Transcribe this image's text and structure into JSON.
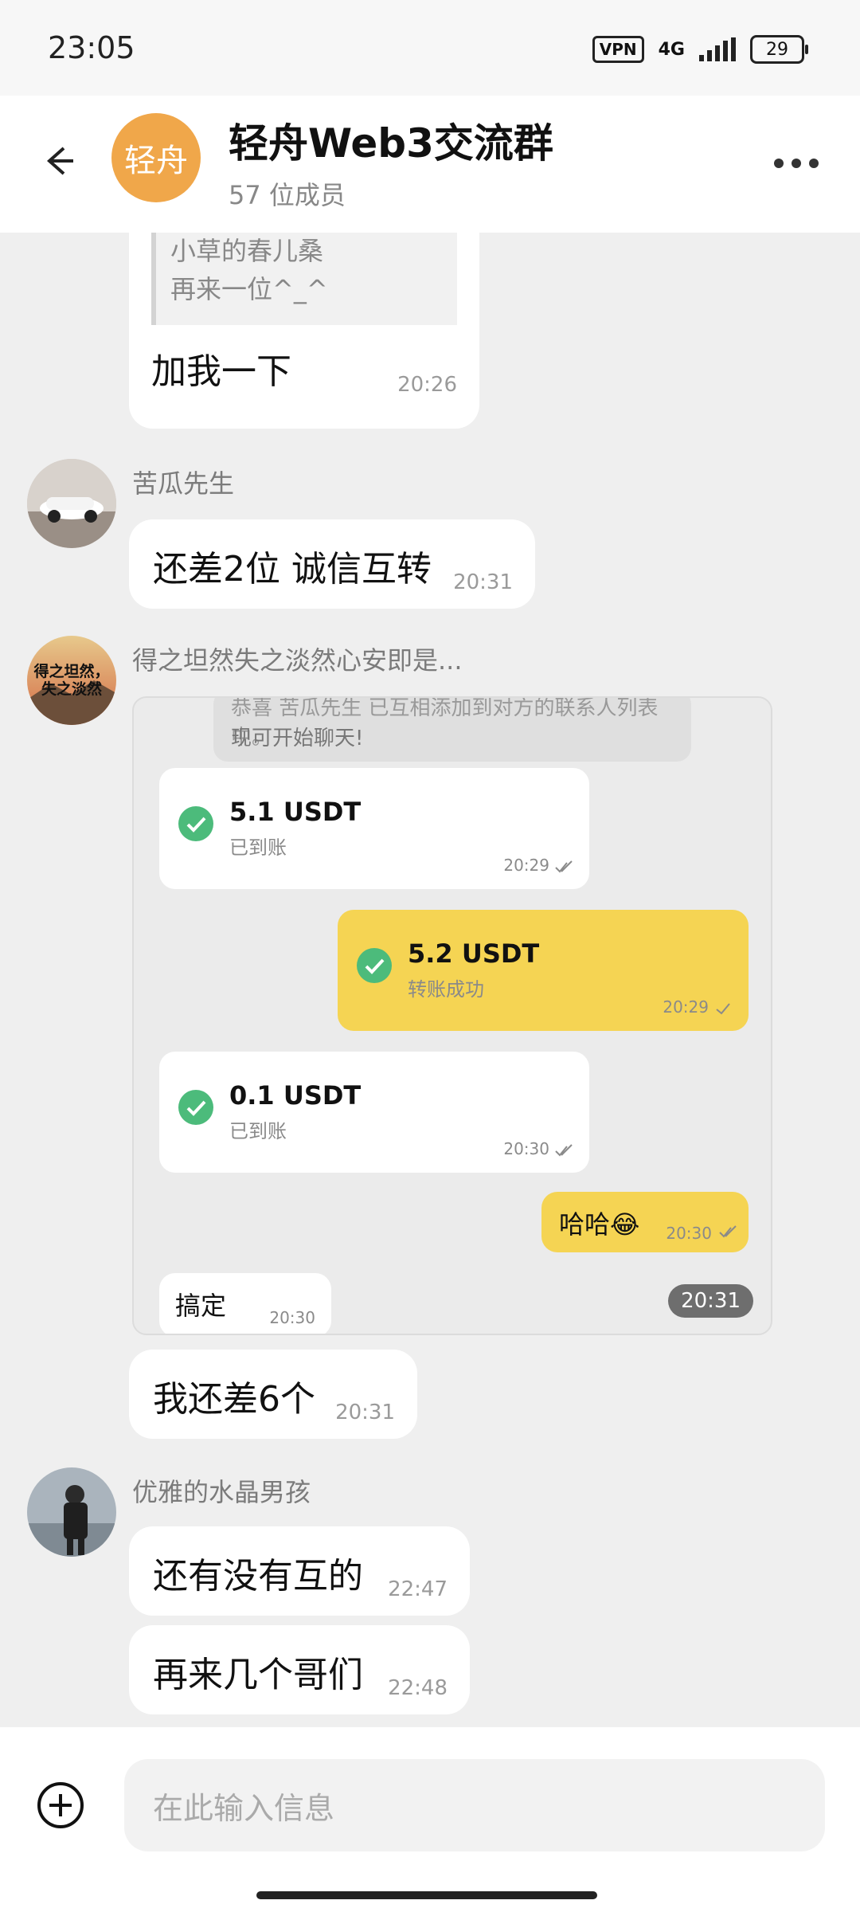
{
  "status_bar": {
    "time": "23:05",
    "vpn": "VPN",
    "network": "4G",
    "battery": "29"
  },
  "header": {
    "avatar_text": "轻舟",
    "title": "轻舟Web3交流群",
    "subtitle": "57 位成员"
  },
  "messages": {
    "m1": {
      "quote_name": "小草的春儿桑",
      "quote_text": "再来一位^_^",
      "text": "加我一下",
      "time": "20:26"
    },
    "m2": {
      "sender": "苦瓜先生",
      "text": "还差2位 诚信互转",
      "time": "20:31"
    },
    "m3": {
      "sender": "得之坦然失之淡然心安即是...",
      "avatar_text": "得之坦然，失之淡然",
      "screenshot": {
        "system_line1": "恭喜 苦瓜先生 已互相添加到对方的联系人列表中。",
        "system_line2": "现可开始聊天!",
        "payments": [
          {
            "amount": "5.1 USDT",
            "status": "已到账",
            "time": "20:29"
          },
          {
            "amount": "5.2 USDT",
            "status": "转账成功",
            "time": "20:29"
          },
          {
            "amount": "0.1 USDT",
            "status": "已到账",
            "time": "20:30"
          }
        ],
        "msg_haha": {
          "text": "哈哈😂",
          "time": "20:30"
        },
        "msg_done": {
          "text": "搞定",
          "time": "20:30"
        },
        "chip_time": "20:31"
      }
    },
    "m4": {
      "text": "我还差6个",
      "time": "20:31"
    },
    "m5": {
      "sender": "优雅的水晶男孩",
      "text": "还有没有互的",
      "time": "22:47"
    },
    "m6": {
      "text": "再来几个哥们",
      "time": "22:48"
    }
  },
  "input": {
    "placeholder": "在此输入信息"
  },
  "colors": {
    "accent_yellow": "#f5d453",
    "avatar_orange": "#f0a74a",
    "check_green": "#4cbb7b"
  }
}
